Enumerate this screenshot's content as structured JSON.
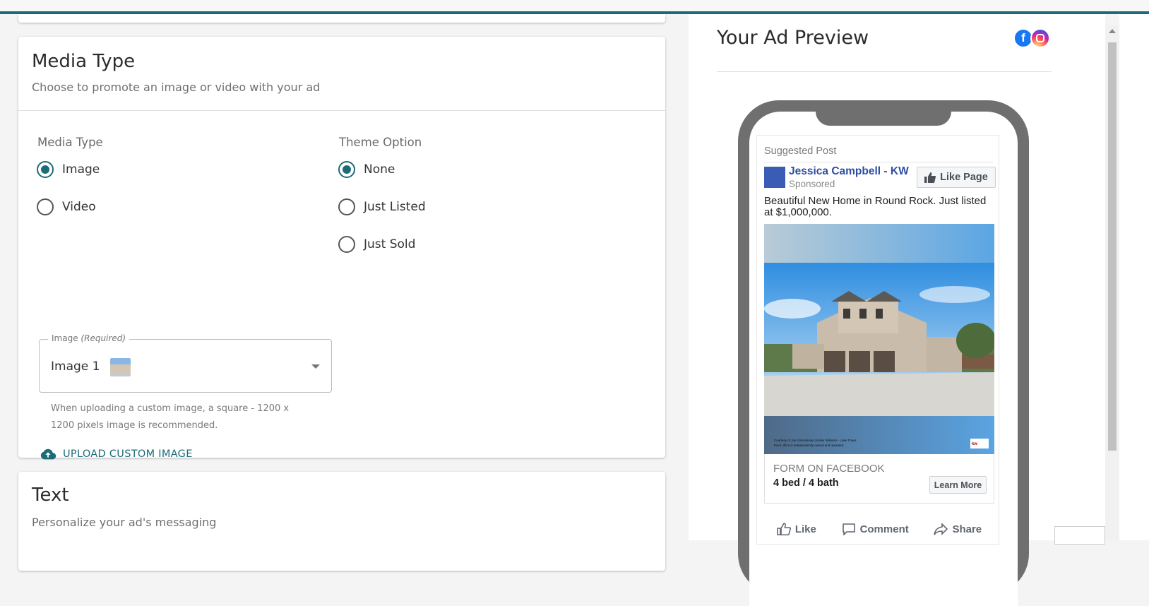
{
  "media_card": {
    "title": "Media Type",
    "subtitle": "Choose to promote an image or video with your ad",
    "media_type": {
      "label": "Media Type",
      "options": [
        {
          "label": "Image",
          "checked": true
        },
        {
          "label": "Video",
          "checked": false
        }
      ]
    },
    "theme_option": {
      "label": "Theme Option",
      "options": [
        {
          "label": "None",
          "checked": true
        },
        {
          "label": "Just Listed",
          "checked": false
        },
        {
          "label": "Just Sold",
          "checked": false
        }
      ]
    },
    "image_select": {
      "label": "Image",
      "required": "(Required)",
      "value": "Image 1"
    },
    "helper_text": "When uploading a custom image, a square - 1200 x 1200 pixels image is recommended.",
    "upload_label": "UPLOAD CUSTOM IMAGE"
  },
  "text_card": {
    "title": "Text",
    "subtitle": "Personalize your ad's messaging"
  },
  "preview": {
    "title": "Your Ad Preview",
    "post": {
      "suggested": "Suggested Post",
      "page_name": "Jessica Campbell - KW",
      "sponsored": "Sponsored",
      "like_page": "Like Page",
      "body": "Beautiful New Home in Round Rock. Just listed at $1,000,000.",
      "image_caption_1": "Courtesy of Joe Garsolinsky | Keller Williams - Lake Travis",
      "image_caption_2": "Each office is independently owned and operated.",
      "form_label": "FORM ON FACEBOOK",
      "form_value": "4 bed / 4 bath",
      "learn_more": "Learn More",
      "actions": {
        "like": "Like",
        "comment": "Comment",
        "share": "Share"
      }
    }
  },
  "colors": {
    "accent": "#1c6b78",
    "facebook_blue": "#2f4ea3"
  }
}
